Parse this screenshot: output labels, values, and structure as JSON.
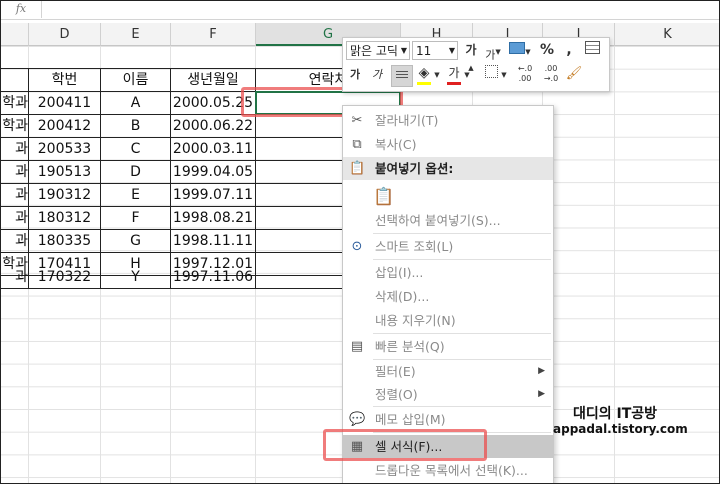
{
  "formula_bar": {
    "fx": "fx"
  },
  "columns": [
    {
      "key": "D",
      "label": "D"
    },
    {
      "key": "E",
      "label": "E"
    },
    {
      "key": "F",
      "label": "F"
    },
    {
      "key": "G",
      "label": "G"
    },
    {
      "key": "H",
      "label": "H"
    },
    {
      "key": "I",
      "label": "I"
    },
    {
      "key": "J",
      "label": "J"
    },
    {
      "key": "K",
      "label": "K"
    }
  ],
  "table": {
    "headers": [
      "학번",
      "이름",
      "생년월일",
      "연락처"
    ],
    "rows": [
      {
        "dept": "학과",
        "id": "200411",
        "name": "A",
        "dob": "2000.05.25"
      },
      {
        "dept": "학과",
        "id": "200412",
        "name": "B",
        "dob": "2000.06.22"
      },
      {
        "dept": "과",
        "id": "200533",
        "name": "C",
        "dob": "2000.03.11"
      },
      {
        "dept": "과",
        "id": "190513",
        "name": "D",
        "dob": "1999.04.05"
      },
      {
        "dept": "과",
        "id": "190312",
        "name": "E",
        "dob": "1999.07.11"
      },
      {
        "dept": "과",
        "id": "180312",
        "name": "F",
        "dob": "1998.08.21"
      },
      {
        "dept": "과",
        "id": "180335",
        "name": "G",
        "dob": "1998.11.11"
      },
      {
        "dept": "학과",
        "id": "170411",
        "name": "H",
        "dob": "1997.12.01"
      },
      {
        "dept": "과",
        "id": "170322",
        "name": "Y",
        "dob": "1997.11.06"
      }
    ]
  },
  "mini_toolbar": {
    "font_name": "맑은 고딕",
    "font_size": "11",
    "grow_font": "가",
    "shrink_font": "가",
    "percent": "%",
    "comma": ",",
    "bold": "가",
    "italic": "가",
    "font_color_letter": "가",
    "inc_decimal": "←.0 .00",
    "dec_decimal": ".00 →.0"
  },
  "context_menu": {
    "cut": "잘라내기(T)",
    "copy": "복사(C)",
    "paste_options": "붙여넣기 옵션:",
    "paste_special": "선택하여 붙여넣기(S)...",
    "smart_lookup": "스마트 조회(L)",
    "insert": "삽입(I)...",
    "delete": "삭제(D)...",
    "clear_contents": "내용 지우기(N)",
    "quick_analysis": "빠른 분석(Q)",
    "filter": "필터(E)",
    "sort": "정렬(O)",
    "insert_comment": "메모 삽입(M)",
    "format_cells": "셀 서식(F)...",
    "pick_from_list": "드롭다운 목록에서 선택(K)..."
  },
  "watermark": {
    "line1": "대디의 IT공방",
    "line2": "appadal.tistory.com"
  },
  "colors": {
    "excel_green": "#217346",
    "highlight_red": "#eb5050",
    "font_color_bar": "#e02020",
    "fill_color_bar": "#ffff00"
  }
}
